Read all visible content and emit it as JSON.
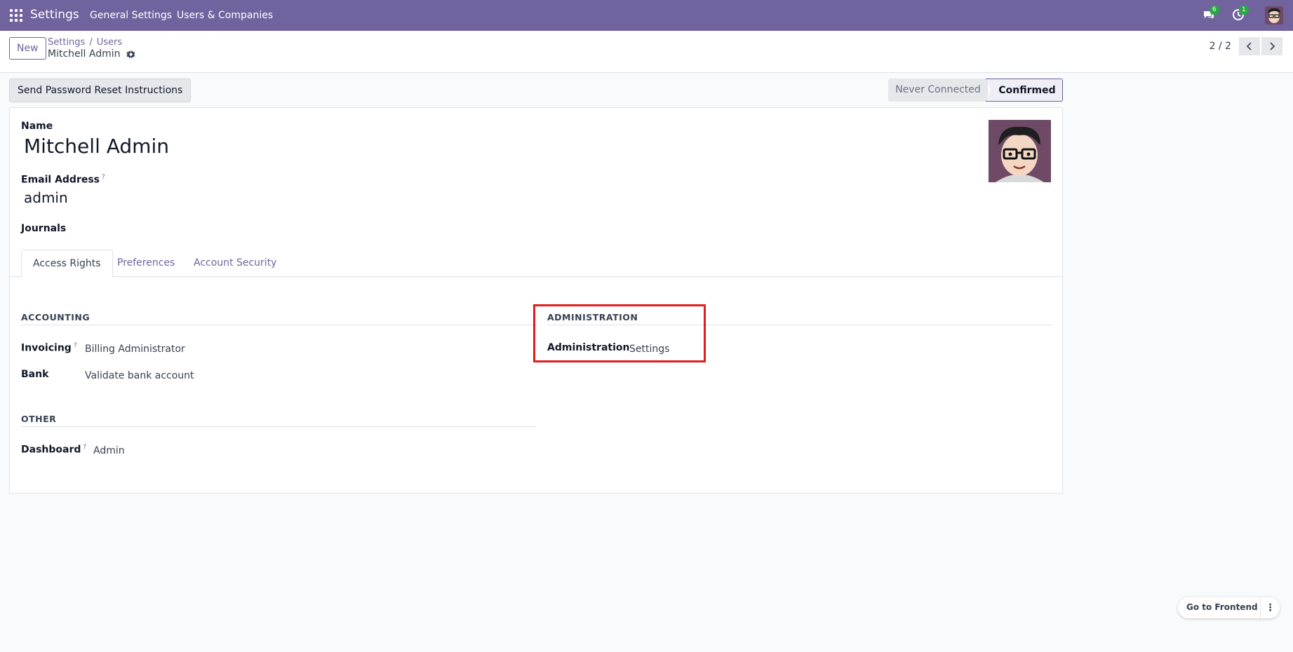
{
  "topnav": {
    "app_name": "Settings",
    "menus": [
      "General Settings",
      "Users & Companies"
    ],
    "messages_count": "6",
    "activities_count": "1"
  },
  "control": {
    "new_label": "New",
    "breadcrumb": [
      "Settings",
      "Users"
    ],
    "title": "Mitchell Admin",
    "pager": "2 / 2"
  },
  "statusbar": {
    "reset_button": "Send Password Reset Instructions",
    "stages": [
      "Never Connected",
      "Confirmed"
    ],
    "active_stage": "Confirmed"
  },
  "form": {
    "name_label": "Name",
    "name_value": "Mitchell Admin",
    "email_label": "Email Address",
    "email_help": "?",
    "email_value": "admin",
    "journals_label": "Journals"
  },
  "tabs": [
    "Access Rights",
    "Preferences",
    "Account Security"
  ],
  "access_rights": {
    "accounting": {
      "title": "ACCOUNTING",
      "fields": [
        {
          "label": "Invoicing",
          "help": "?",
          "value": "Billing Administrator"
        },
        {
          "label": "Bank",
          "help": "",
          "value": "Validate bank account"
        }
      ]
    },
    "other": {
      "title": "OTHER",
      "fields": [
        {
          "label": "Dashboard",
          "help": "?",
          "value": "Admin"
        }
      ]
    },
    "administration": {
      "title": "ADMINISTRATION",
      "fields": [
        {
          "label": "Administration",
          "help": "",
          "value": "Settings"
        }
      ]
    }
  },
  "frontend_button": "Go to Frontend",
  "colors": {
    "brand": "#71639e",
    "highlight": "#e11d1d",
    "badge": "#28a745"
  }
}
